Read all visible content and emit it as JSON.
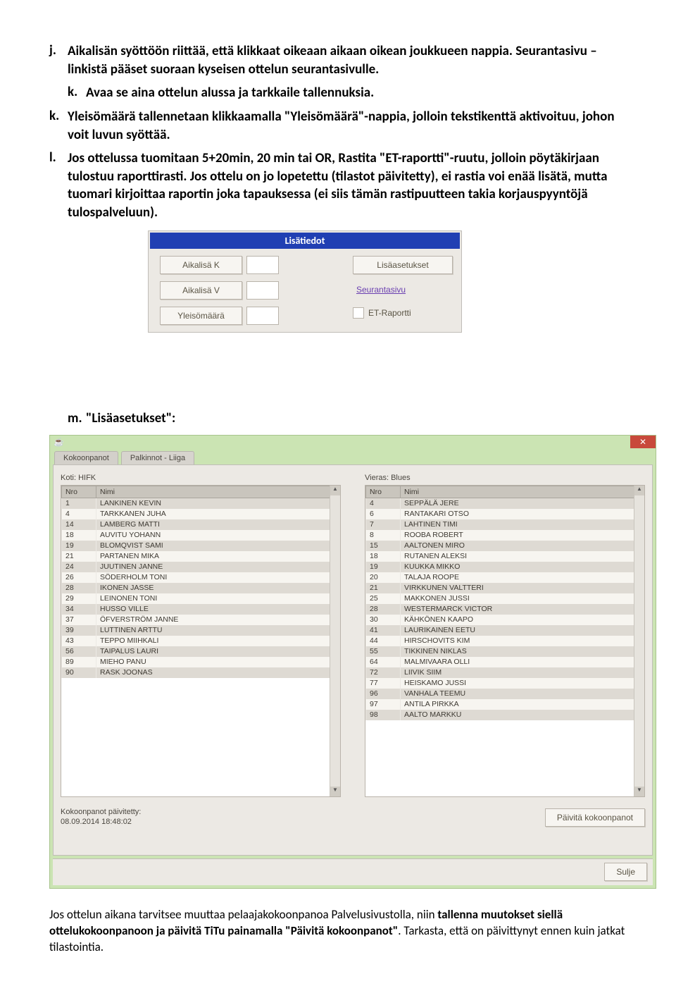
{
  "items": {
    "j": {
      "letter": "j.",
      "text": "Aikalisän syöttöön riittää, että klikkaat oikeaan aikaan oikean joukkueen nappia. Seurantasivu –linkistä pääset suoraan kyseisen ottelun seurantasivulle."
    },
    "k": {
      "letter": "k.",
      "text": "Avaa se aina ottelun alussa ja tarkkaile tallennuksia."
    },
    "k2": {
      "letter": "k.",
      "text": "Yleisömäärä tallennetaan klikkaamalla \"Yleisömäärä\"-nappia, jolloin tekstikenttä aktivoituu, johon voit luvun syöttää."
    },
    "l": {
      "letter": "l.",
      "text": "Jos ottelussa tuomitaan 5+20min, 20 min tai OR, Rastita \"ET-raportti\"-ruutu, jolloin pöytäkirjaan tulostuu raporttirasti. Jos ottelu on jo lopetettu (tilastot päivitetty), ei rastia voi enää lisätä, mutta tuomari kirjoittaa raportin joka tapauksessa (ei siis tämän rastipuutteen takia korjauspyyntöjä tulospalveluun)."
    },
    "m": {
      "letter": "m.",
      "text": "\"Lisäasetukset\":"
    }
  },
  "panel1": {
    "title": "Lisätiedot",
    "btn_aikalisa_k": "Aikalisä K",
    "btn_aikalisa_v": "Aikalisä V",
    "btn_yleisomaara": "Yleisömäärä",
    "btn_lisaasetukset": "Lisäasetukset",
    "link_seurantasivu": "Seurantasivu",
    "cb_etraportti": "ET-Raportti"
  },
  "app": {
    "close_x": "✕",
    "java_icon": "☕",
    "tabs": [
      "Kokoonpanot",
      "Palkinnot - Liiga"
    ],
    "home_label": "Koti: HIFK",
    "away_label": "Vieras: Blues",
    "col_nro": "Nro",
    "col_nimi": "Nimi",
    "home_roster": [
      {
        "nro": "1",
        "nimi": "LANKINEN KEVIN"
      },
      {
        "nro": "4",
        "nimi": "TARKKANEN JUHA"
      },
      {
        "nro": "14",
        "nimi": "LAMBERG MATTI"
      },
      {
        "nro": "18",
        "nimi": "AUVITU YOHANN"
      },
      {
        "nro": "19",
        "nimi": "BLOMQVIST SAMI"
      },
      {
        "nro": "21",
        "nimi": "PARTANEN MIKA"
      },
      {
        "nro": "24",
        "nimi": "JUUTINEN JANNE"
      },
      {
        "nro": "26",
        "nimi": "SÖDERHOLM TONI"
      },
      {
        "nro": "28",
        "nimi": "IKONEN JASSE"
      },
      {
        "nro": "29",
        "nimi": "LEINONEN TONI"
      },
      {
        "nro": "34",
        "nimi": "HUSSO VILLE"
      },
      {
        "nro": "37",
        "nimi": "ÖFVERSTRÖM JANNE"
      },
      {
        "nro": "39",
        "nimi": "LUTTINEN ARTTU"
      },
      {
        "nro": "43",
        "nimi": "TEPPO MIIHKALI"
      },
      {
        "nro": "56",
        "nimi": "TAIPALUS LAURI"
      },
      {
        "nro": "89",
        "nimi": "MIEHO PANU"
      },
      {
        "nro": "90",
        "nimi": "RASK JOONAS"
      }
    ],
    "away_roster": [
      {
        "nro": "4",
        "nimi": "SEPPÄLÄ JERE"
      },
      {
        "nro": "6",
        "nimi": "RANTAKARI OTSO"
      },
      {
        "nro": "7",
        "nimi": "LAHTINEN TIMI"
      },
      {
        "nro": "8",
        "nimi": "ROOBA ROBERT"
      },
      {
        "nro": "15",
        "nimi": "AALTONEN MIRO"
      },
      {
        "nro": "18",
        "nimi": "RUTANEN ALEKSI"
      },
      {
        "nro": "19",
        "nimi": "KUUKKA MIKKO"
      },
      {
        "nro": "20",
        "nimi": "TALAJA ROOPE"
      },
      {
        "nro": "21",
        "nimi": "VIRKKUNEN VALTTERI"
      },
      {
        "nro": "25",
        "nimi": "MAKKONEN JUSSI"
      },
      {
        "nro": "28",
        "nimi": "WESTERMARCK VICTOR"
      },
      {
        "nro": "30",
        "nimi": "KÄHKÖNEN KAAPO"
      },
      {
        "nro": "41",
        "nimi": "LAURIKAINEN EETU"
      },
      {
        "nro": "44",
        "nimi": "HIRSCHOVITS KIM"
      },
      {
        "nro": "55",
        "nimi": "TIKKINEN NIKLAS"
      },
      {
        "nro": "64",
        "nimi": "MALMIVAARA OLLI"
      },
      {
        "nro": "72",
        "nimi": "LIIVIK SIIM"
      },
      {
        "nro": "77",
        "nimi": "HEISKAMO JUSSI"
      },
      {
        "nro": "96",
        "nimi": "VANHALA TEEMU"
      },
      {
        "nro": "97",
        "nimi": "ANTILA PIRKKA"
      },
      {
        "nro": "98",
        "nimi": "AALTO MARKKU"
      }
    ],
    "ts_label": "Kokoonpanot päivitetty:",
    "ts_value": "08.09.2014 18:48:02",
    "btn_update": "Päivitä kokoonpanot",
    "btn_close": "Sulje"
  },
  "endtext": {
    "p1a": "Jos ottelun aikana tarvitsee muuttaa pelaajakokoonpanoa Palvelusivustolla, niin ",
    "p1b": "tallenna muutokset siellä ottelukokoonpanoon ja päivitä TiTu painamalla \"Päivitä kokoonpanot\"",
    "p1c": ". Tarkasta, että on päivittynyt ennen kuin jatkat tilastointia."
  }
}
